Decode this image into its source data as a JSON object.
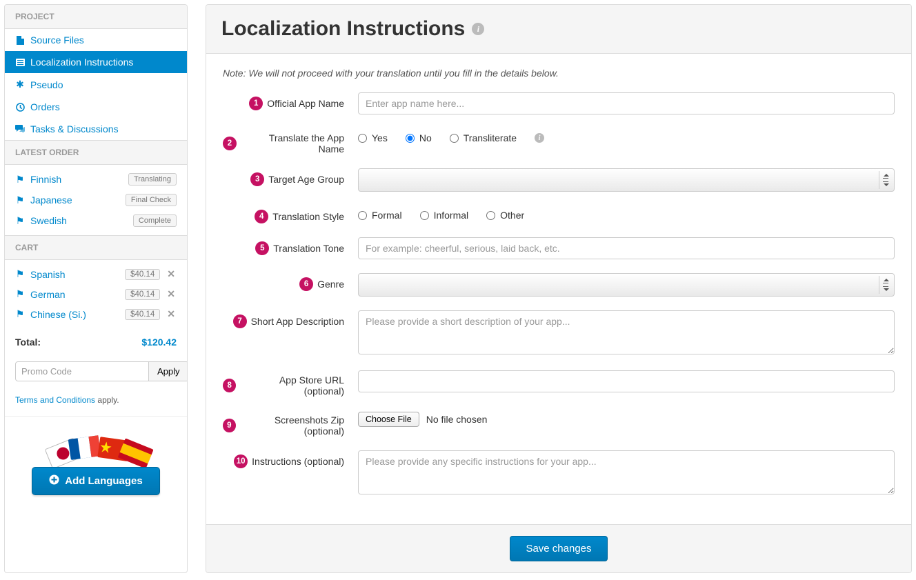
{
  "sidebar": {
    "sections": {
      "project": {
        "title": "Project",
        "items": [
          {
            "label": "Source Files",
            "icon": "file-icon"
          },
          {
            "label": "Localization Instructions",
            "icon": "list-icon"
          },
          {
            "label": "Pseudo",
            "icon": "asterisk-icon"
          },
          {
            "label": "Orders",
            "icon": "clock-icon"
          },
          {
            "label": "Tasks & Discussions",
            "icon": "comments-icon"
          }
        ],
        "active_index": 1
      },
      "latest_order": {
        "title": "Latest Order",
        "items": [
          {
            "lang": "Finnish",
            "status": "Translating"
          },
          {
            "lang": "Japanese",
            "status": "Final Check"
          },
          {
            "lang": "Swedish",
            "status": "Complete"
          }
        ]
      },
      "cart": {
        "title": "Cart",
        "items": [
          {
            "lang": "Spanish",
            "price": "$40.14"
          },
          {
            "lang": "German",
            "price": "$40.14"
          },
          {
            "lang": "Chinese (Si.)",
            "price": "$40.14"
          }
        ],
        "total_label": "Total:",
        "total_amount": "$120.42",
        "promo_placeholder": "Promo Code",
        "apply_label": "Apply",
        "terms_link": "Terms and Conditions",
        "terms_suffix": " apply.",
        "add_languages_label": "Add Languages"
      }
    }
  },
  "main": {
    "title": "Localization Instructions",
    "note": "Note: We will not proceed with your translation until you fill in the details below.",
    "fields": {
      "f1": {
        "num": "1",
        "label": "Official App Name",
        "placeholder": "Enter app name here..."
      },
      "f2": {
        "num": "2",
        "label": "Translate the App Name",
        "options": {
          "yes": "Yes",
          "no": "No",
          "translit": "Transliterate"
        }
      },
      "f3": {
        "num": "3",
        "label": "Target Age Group"
      },
      "f4": {
        "num": "4",
        "label": "Translation Style",
        "options": {
          "formal": "Formal",
          "informal": "Informal",
          "other": "Other"
        }
      },
      "f5": {
        "num": "5",
        "label": "Translation Tone",
        "placeholder": "For example: cheerful, serious, laid back, etc."
      },
      "f6": {
        "num": "6",
        "label": "Genre"
      },
      "f7": {
        "num": "7",
        "label": "Short App Description",
        "placeholder": "Please provide a short description of your app..."
      },
      "f8": {
        "num": "8",
        "label": "App Store URL (optional)"
      },
      "f9": {
        "num": "9",
        "label": "Screenshots Zip (optional)",
        "choose": "Choose File",
        "no_file": "No file chosen"
      },
      "f10": {
        "num": "10",
        "label": "Instructions (optional)",
        "placeholder": "Please provide any specific instructions for your app..."
      }
    },
    "save_label": "Save changes"
  }
}
